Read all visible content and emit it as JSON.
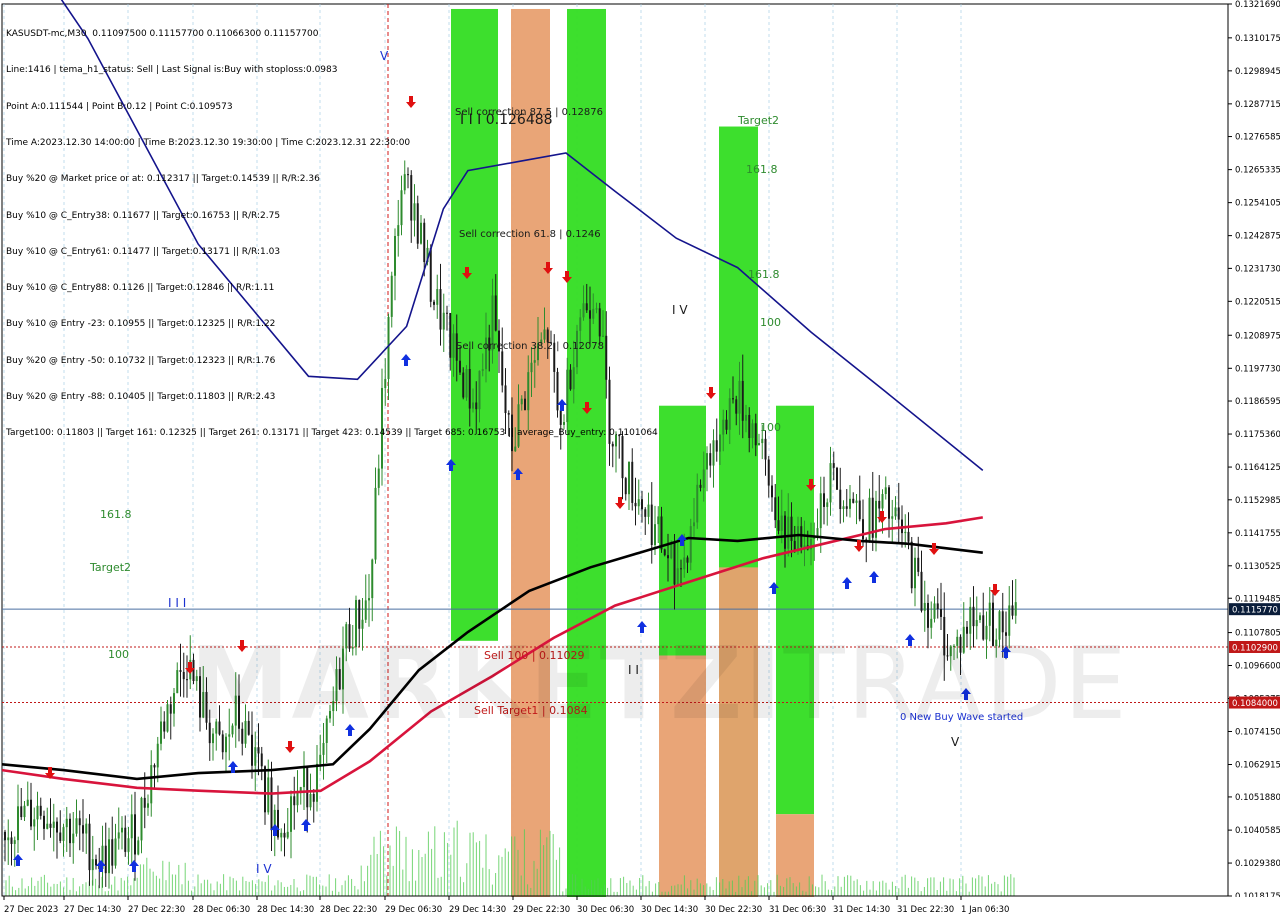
{
  "window": {
    "title": "KASUSDT-mc,M30"
  },
  "info_panel": {
    "lines": [
      "KASUSDT-mc,M30  0.11097500 0.11157700 0.11066300 0.11157700",
      "Line:1416 | tema_h1_status: Sell | Last Signal is:Buy with stoploss:0.0983",
      "Point A:0.111544 | Point B:0.12 | Point C:0.109573",
      "Time A:2023.12.30 14:00:00 | Time B:2023.12.30 19:30:00 | Time C:2023.12.31 22:30:00",
      "Buy %20 @ Market price or at: 0.112317 || Target:0.14539 || R/R:2.36",
      "Buy %10 @ C_Entry38: 0.11677 || Target:0.16753 || R/R:2.75",
      "Buy %10 @ C_Entry61: 0.11477 || Target:0.13171 || R/R:1.03",
      "Buy %10 @ C_Entry88: 0.1126 || Target:0.12846 || R/R:1.11",
      "Buy %10 @ Entry -23: 0.10955 || Target:0.12325 || R/R:1.22",
      "Buy %20 @ Entry -50: 0.10732 || Target:0.12323 || R/R:1.76",
      "Buy %20 @ Entry -88: 0.10405 || Target:0.11803 || R/R:2.43",
      "Target100: 0.11803 || Target 161: 0.12325 || Target 261: 0.13171 || Target 423: 0.14539 || Target 685: 0.16753 || average_Buy_entry: 0.1101064"
    ]
  },
  "watermark": {
    "bold": "MARKETZI",
    "light": "TRADE"
  },
  "colors": {
    "background": "#ffffff",
    "bull_candle": "#2e8b2e",
    "bear_candle": "#1a1a1a",
    "green_zone": "#33dd22",
    "orange_zone": "#e8a070",
    "ma_blue": "#14148c",
    "ma_black": "#000000",
    "ma_red": "#d8143c",
    "buy_arrow": "#1030e0",
    "sell_arrow": "#e01010",
    "current_price_line": "#4a6fa0",
    "red_level": "#c01818",
    "grid": "#a9cfe8",
    "volume": "#55cc55"
  },
  "chart_data": {
    "type": "candlestick",
    "symbol": "KASUSDT-mc",
    "timeframe": "M30",
    "y_range": [
      0.101817,
      0.132169
    ],
    "y_ticks": [
      "0.1321690",
      "0.1310175",
      "0.1298945",
      "0.1287715",
      "0.1276585",
      "0.1265335",
      "0.1254105",
      "0.1242875",
      "0.1231730",
      "0.1220515",
      "0.1208975",
      "0.1197730",
      "0.1186595",
      "0.1175360",
      "0.1164125",
      "0.1152985",
      "0.1141755",
      "0.1130525",
      "0.1119485",
      "0.1107805",
      "0.1096600",
      "0.1085375",
      "0.1074150",
      "0.1062915",
      "0.1051880",
      "0.1040585",
      "0.1029380",
      "0.1018175"
    ],
    "x_ticks": [
      "27 Dec 2023",
      "27 Dec 14:30",
      "27 Dec 22:30",
      "28 Dec 06:30",
      "28 Dec 14:30",
      "28 Dec 22:30",
      "29 Dec 06:30",
      "29 Dec 14:30",
      "29 Dec 22:30",
      "30 Dec 06:30",
      "30 Dec 14:30",
      "30 Dec 22:30",
      "31 Dec 06:30",
      "31 Dec 14:30",
      "31 Dec 22:30",
      "1 Jan 06:30"
    ],
    "price_labels": {
      "current": "0.1115770",
      "red_level_1": "0.1102900",
      "red_level_2": "0.1084000"
    },
    "zones": [
      {
        "type": "green",
        "y_from": 0.132,
        "y_to": 0.1105
      },
      {
        "type": "orange",
        "y_from": 0.132,
        "y_to": 0.1016
      },
      {
        "type": "green",
        "y_from": 0.132,
        "y_to": 0.1016
      },
      {
        "type": "green",
        "y_from": 0.128,
        "y_to": 0.1016
      },
      {
        "type": "orange",
        "y_from": 0.113,
        "y_to": 0.1016
      },
      {
        "type": "green",
        "y_from": 0.1185,
        "y_to": 0.11
      },
      {
        "type": "orange",
        "y_from": 0.11,
        "y_to": 0.1016
      },
      {
        "type": "green",
        "y_from": 0.1185,
        "y_to": 0.1046
      },
      {
        "type": "orange",
        "y_from": 0.1046,
        "y_to": 0.1016
      }
    ],
    "annotations": [
      {
        "text": "Sell correction 87.5 | 0.12876",
        "color": "#1a1a1a"
      },
      {
        "text": "I I I 0.126488",
        "color": "#1a1a1a"
      },
      {
        "text": "Sell correction 61.8 | 0.1246",
        "color": "#1a1a1a"
      },
      {
        "text": "Sell correction 38.2 | 0.12078",
        "color": "#1a1a1a"
      },
      {
        "text": "I V",
        "color": "#1a1a1a"
      },
      {
        "text": "Target2",
        "color": "#2e8b2e"
      },
      {
        "text": "161.8",
        "color": "#2e8b2e"
      },
      {
        "text": "161.8",
        "color": "#2e8b2e"
      },
      {
        "text": "100",
        "color": "#2e8b2e"
      },
      {
        "text": "100",
        "color": "#2e8b2e"
      },
      {
        "text": "161.8",
        "color": "#2e8b2e"
      },
      {
        "text": "Target2",
        "color": "#2e8b2e"
      },
      {
        "text": "100",
        "color": "#2e8b2e"
      },
      {
        "text": "I I I",
        "color": "#1a30d0"
      },
      {
        "text": "I V",
        "color": "#1a30d0"
      },
      {
        "text": "V",
        "color": "#1a30d0"
      },
      {
        "text": "I I",
        "color": "#1a1a1a"
      },
      {
        "text": "Sell 100 | 0.11029",
        "color": "#c01818"
      },
      {
        "text": "Sell Target1 | 0.1084",
        "color": "#c01818"
      },
      {
        "text": "0 New Buy Wave started",
        "color": "#1a30d0"
      },
      {
        "text": "V",
        "color": "#1a1a1a"
      }
    ],
    "ma_blue": [
      [
        0,
        0.1353
      ],
      [
        0.07,
        0.131
      ],
      [
        0.16,
        0.124
      ],
      [
        0.25,
        0.1195
      ],
      [
        0.29,
        0.1194
      ],
      [
        0.33,
        0.1212
      ],
      [
        0.36,
        0.1252
      ],
      [
        0.38,
        0.1265
      ],
      [
        0.42,
        0.1268
      ],
      [
        0.46,
        0.1271
      ],
      [
        0.5,
        0.1258
      ],
      [
        0.55,
        0.1242
      ],
      [
        0.6,
        0.1232
      ],
      [
        0.66,
        0.121
      ],
      [
        0.72,
        0.119
      ],
      [
        0.8,
        0.1163
      ]
    ],
    "ma_black": [
      [
        0,
        0.1063
      ],
      [
        0.05,
        0.1061
      ],
      [
        0.11,
        0.1058
      ],
      [
        0.16,
        0.106
      ],
      [
        0.22,
        0.1061
      ],
      [
        0.27,
        0.1063
      ],
      [
        0.3,
        0.1075
      ],
      [
        0.34,
        0.1095
      ],
      [
        0.38,
        0.1108
      ],
      [
        0.43,
        0.1122
      ],
      [
        0.48,
        0.113
      ],
      [
        0.52,
        0.1135
      ],
      [
        0.56,
        0.114
      ],
      [
        0.6,
        0.1139
      ],
      [
        0.65,
        0.1141
      ],
      [
        0.7,
        0.1139
      ],
      [
        0.74,
        0.1138
      ],
      [
        0.8,
        0.1135
      ]
    ],
    "ma_red": [
      [
        0,
        0.1061
      ],
      [
        0.05,
        0.1058
      ],
      [
        0.11,
        0.1055
      ],
      [
        0.16,
        0.1054
      ],
      [
        0.22,
        0.1053
      ],
      [
        0.26,
        0.1054
      ],
      [
        0.3,
        0.1064
      ],
      [
        0.35,
        0.1081
      ],
      [
        0.4,
        0.1093
      ],
      [
        0.45,
        0.1106
      ],
      [
        0.5,
        0.1117
      ],
      [
        0.56,
        0.1125
      ],
      [
        0.62,
        0.1133
      ],
      [
        0.67,
        0.1138
      ],
      [
        0.72,
        0.1143
      ],
      [
        0.77,
        0.1145
      ],
      [
        0.8,
        0.1147
      ]
    ]
  }
}
